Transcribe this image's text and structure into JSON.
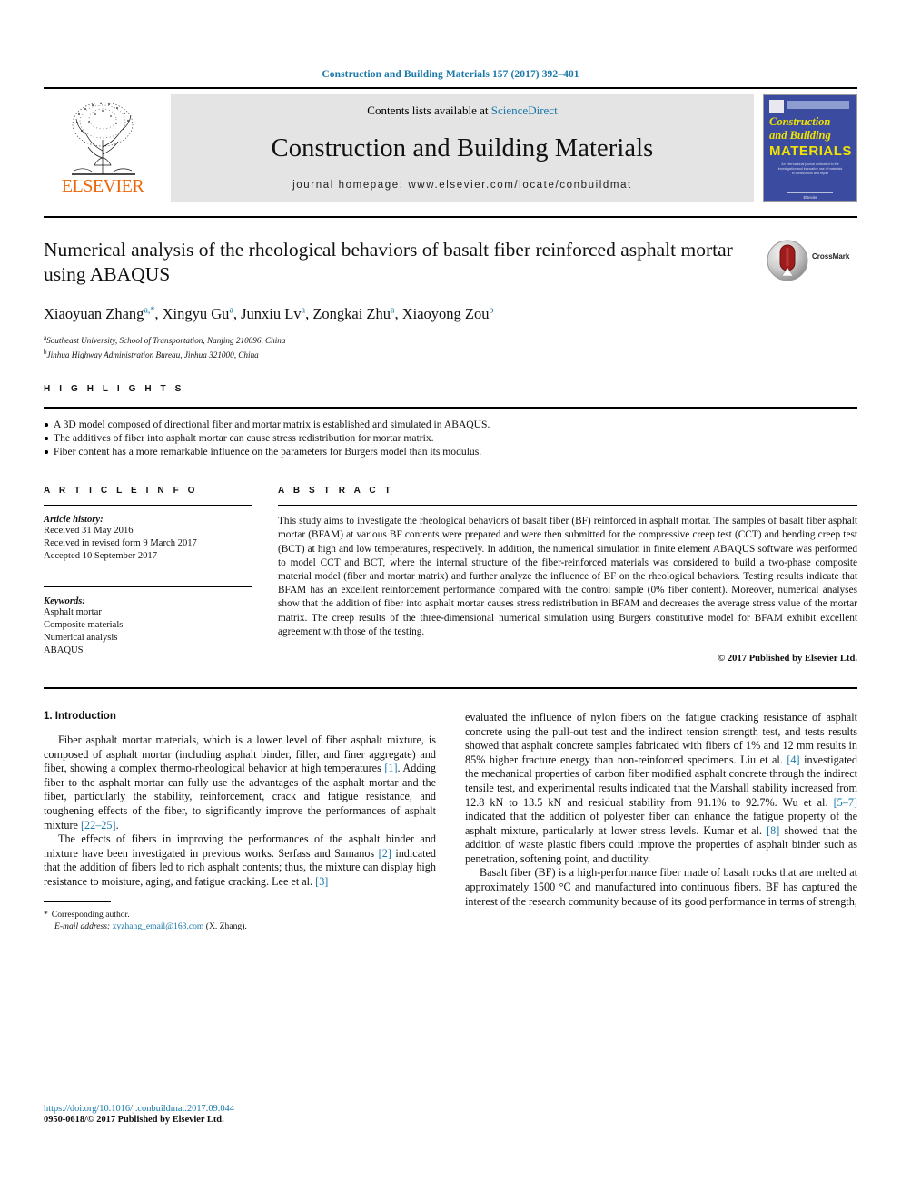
{
  "running_head": "Construction and Building Materials 157 (2017) 392–401",
  "banner": {
    "publisher_name": "ELSEVIER",
    "contents_prefix": "Contents lists available at ",
    "contents_link": "ScienceDirect",
    "journal_title": "Construction and Building Materials",
    "homepage": "journal homepage: www.elsevier.com/locate/conbuildmat",
    "cover": {
      "line1": "Construction",
      "line2": "and Building",
      "line3": "MATERIALS",
      "blurb": "An international journal dedicated to the investigation and innovative use of materials in construction and repair",
      "foot": "Elsevier"
    }
  },
  "article": {
    "title": "Numerical analysis of the rheological behaviors of basalt fiber reinforced asphalt mortar using ABAQUS",
    "crossmark_label": "CrossMark",
    "authors": [
      {
        "name": "Xiaoyuan Zhang",
        "marks": "a,*"
      },
      {
        "name": "Xingyu Gu",
        "marks": "a"
      },
      {
        "name": "Junxiu Lv",
        "marks": "a"
      },
      {
        "name": "Zongkai Zhu",
        "marks": "a"
      },
      {
        "name": "Xiaoyong Zou",
        "marks": "b"
      }
    ],
    "affiliations": [
      {
        "mark": "a",
        "text": "Southeast University, School of Transportation, Nanjing 210096, China"
      },
      {
        "mark": "b",
        "text": "Jinhua Highway Administration Bureau, Jinhua 321000, China"
      }
    ]
  },
  "highlights": {
    "label": "H I G H L I G H T S",
    "items": [
      "A 3D model composed of directional fiber and mortar matrix is established and simulated in ABAQUS.",
      "The additives of fiber into asphalt mortar can cause stress redistribution for mortar matrix.",
      "Fiber content has a more remarkable influence on the parameters for Burgers model than its modulus."
    ]
  },
  "article_info": {
    "label": "A R T I C L E    I N F O",
    "history_label": "Article history:",
    "history": [
      "Received 31 May 2016",
      "Received in revised form 9 March 2017",
      "Accepted 10 September 2017"
    ],
    "keywords_label": "Keywords:",
    "keywords": [
      "Asphalt mortar",
      "Composite materials",
      "Numerical analysis",
      "ABAQUS"
    ]
  },
  "abstract": {
    "label": "A B S T R A C T",
    "text": "This study aims to investigate the rheological behaviors of basalt fiber (BF) reinforced in asphalt mortar. The samples of basalt fiber asphalt mortar (BFAM) at various BF contents were prepared and were then submitted for the compressive creep test (CCT) and bending creep test (BCT) at high and low temperatures, respectively. In addition, the numerical simulation in finite element ABAQUS software was performed to model CCT and BCT, where the internal structure of the fiber-reinforced materials was considered to build a two-phase composite material model (fiber and mortar matrix) and further analyze the influence of BF on the rheological behaviors. Testing results indicate that BFAM has an excellent reinforcement performance compared with the control sample (0% fiber content). Moreover, numerical analyses show that the addition of fiber into asphalt mortar causes stress redistribution in BFAM and decreases the average stress value of the mortar matrix. The creep results of the three-dimensional numerical simulation using Burgers constitutive model for BFAM exhibit excellent agreement with those of the testing.",
    "copyright": "© 2017 Published by Elsevier Ltd."
  },
  "body": {
    "section_heading": "1. Introduction",
    "left_paragraphs": [
      {
        "segments": [
          {
            "t": "Fiber asphalt mortar materials, which is a lower level of fiber asphalt mixture, is composed of asphalt mortar (including asphalt binder, filler, and finer aggregate) and fiber, showing a complex thermo-rheological behavior at high temperatures "
          },
          {
            "t": "[1]",
            "ref": true
          },
          {
            "t": ". Adding fiber to the asphalt mortar can fully use the advantages of the asphalt mortar and the fiber, particularly the stability, reinforcement, crack and fatigue resistance, and toughening effects of the fiber, to significantly improve the performances of asphalt mixture "
          },
          {
            "t": "[22–25]",
            "ref": true
          },
          {
            "t": "."
          }
        ]
      },
      {
        "segments": [
          {
            "t": "The effects of fibers in improving the performances of the asphalt binder and mixture have been investigated in previous works. Serfass and Samanos "
          },
          {
            "t": "[2]",
            "ref": true
          },
          {
            "t": " indicated that the addition of fibers led to rich asphalt contents; thus, the mixture can display high resistance to moisture, aging, and fatigue cracking. Lee et al. "
          },
          {
            "t": "[3]",
            "ref": true
          }
        ]
      }
    ],
    "right_paragraphs": [
      {
        "segments": [
          {
            "t": "evaluated the influence of nylon fibers on the fatigue cracking resistance of asphalt concrete using the pull-out test and the indirect tension strength test, and tests results showed that asphalt concrete samples fabricated with fibers of 1% and 12 mm results in 85% higher fracture energy than non-reinforced specimens. Liu et al. "
          },
          {
            "t": "[4]",
            "ref": true
          },
          {
            "t": " investigated the mechanical properties of carbon fiber modified asphalt concrete through the indirect tensile test, and experimental results indicated that the Marshall stability increased from 12.8 kN to 13.5 kN and residual stability from 91.1% to 92.7%. Wu et al. "
          },
          {
            "t": "[5–7]",
            "ref": true
          },
          {
            "t": " indicated that the addition of polyester fiber can enhance the fatigue property of the asphalt mixture, particularly at lower stress levels. Kumar et al. "
          },
          {
            "t": "[8]",
            "ref": true
          },
          {
            "t": " showed that the addition of waste plastic fibers could improve the properties of asphalt binder such as penetration, softening point, and ductility."
          }
        ]
      },
      {
        "segments": [
          {
            "t": "Basalt fiber (BF) is a high-performance fiber made of basalt rocks that are melted at approximately 1500 °C and manufactured into continuous fibers. BF has captured the interest of the research community because of its good performance in terms of strength,"
          }
        ]
      }
    ]
  },
  "footnote": {
    "star": "*",
    "corresponding": "Corresponding author.",
    "email_label": "E-mail address:",
    "email": "xyzhang_email@163.com",
    "email_suffix": "(X. Zhang)."
  },
  "page_footer": {
    "doi": "https://doi.org/10.1016/j.conbuildmat.2017.09.044",
    "issn": "0950-0618/© 2017 Published by Elsevier Ltd."
  },
  "colors": {
    "link": "#1878a8",
    "elsevier_orange": "#ec6608",
    "cover_blue": "#3b4ba0",
    "cover_yellow": "#f2e400"
  }
}
